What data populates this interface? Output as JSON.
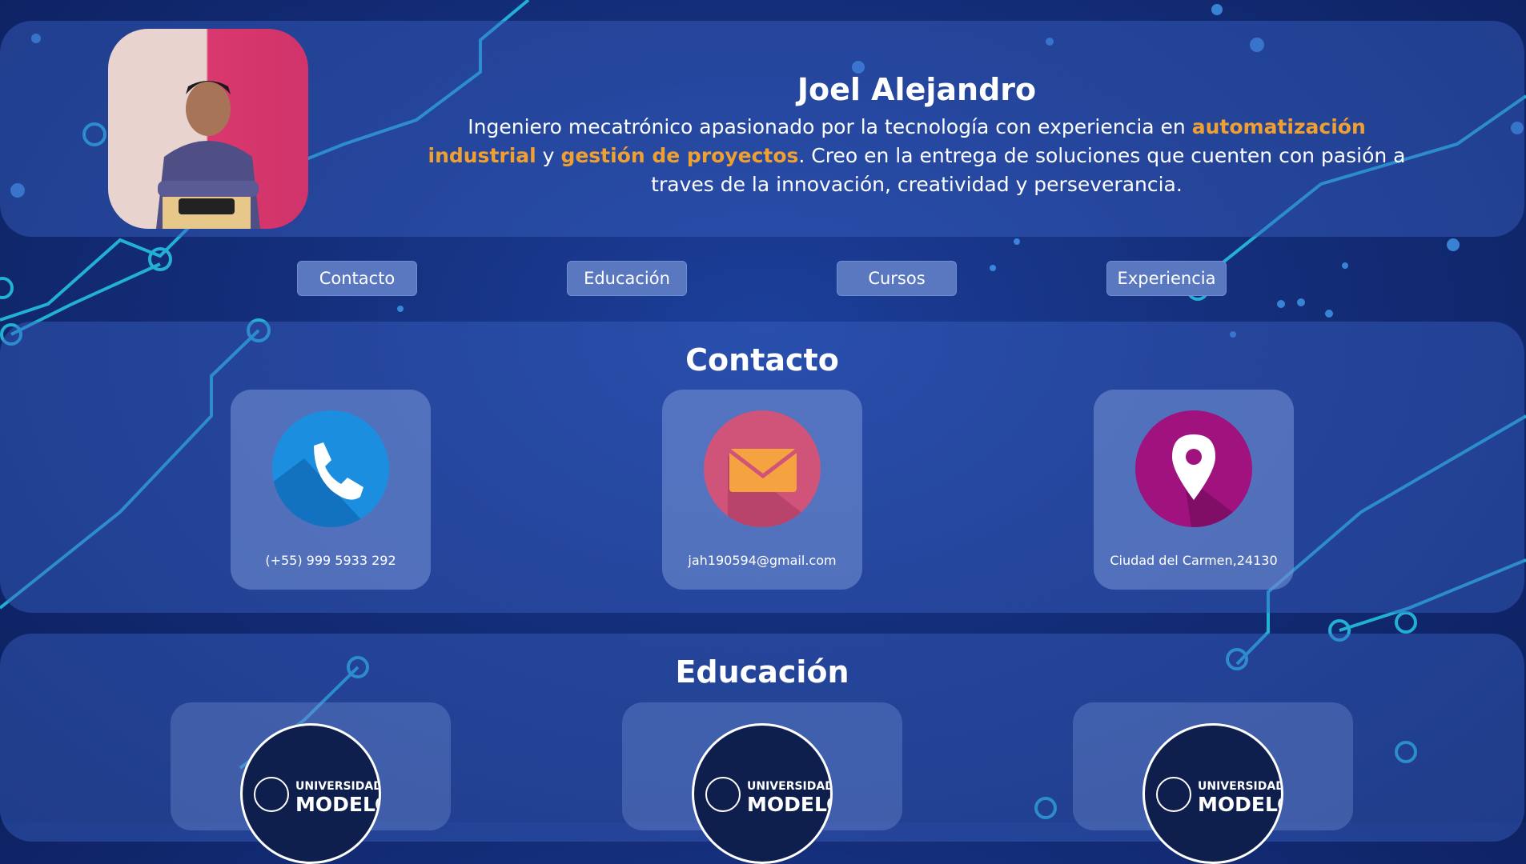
{
  "profile": {
    "name": "Joel Alejandro",
    "bio_part1": "Ingeniero mecatrónico apasionado por la tecnología con experiencia en ",
    "bio_hl1": "automatización industrial",
    "bio_part2": " y ",
    "bio_hl2": "gestión de proyectos",
    "bio_part3": ". Creo en la entrega de soluciones que cuenten con pasión a traves de la innovación, creatividad y perseverancia."
  },
  "nav": {
    "items": [
      {
        "label": "Contacto"
      },
      {
        "label": "Educación"
      },
      {
        "label": "Cursos"
      },
      {
        "label": "Experiencia"
      }
    ]
  },
  "contact": {
    "title": "Contacto",
    "cards": [
      {
        "icon": "phone-icon",
        "text": "(+55) 999 5933 292",
        "color": "#1b8ee0"
      },
      {
        "icon": "mail-icon",
        "text": "jah190594@gmail.com",
        "color": "#d0547a"
      },
      {
        "icon": "location-pin-icon",
        "text": "Ciudad del Carmen,24130",
        "color": "#a0127e"
      }
    ]
  },
  "education": {
    "title": "Educación",
    "cards": [
      {
        "logo_top": "UNIVERSIDAD",
        "logo_bottom": "MODELO"
      },
      {
        "logo_top": "UNIVERSIDAD",
        "logo_bottom": "MODELO"
      },
      {
        "logo_top": "UNIVERSIDAD",
        "logo_bottom": "MODELO"
      }
    ]
  },
  "colors": {
    "accent": "#f0a030",
    "button": "#5a78c0",
    "background": "#142e7a"
  }
}
